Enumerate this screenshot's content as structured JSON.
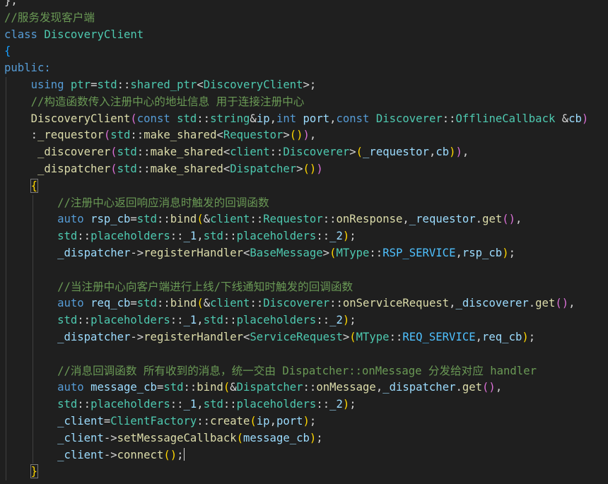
{
  "editor": {
    "lines": [
      {
        "indent": 0,
        "tokens": [
          {
            "t": "};",
            "c": "plain"
          }
        ]
      },
      {
        "indent": 0,
        "tokens": [
          {
            "t": "//服务发现客户端",
            "c": "comment"
          }
        ]
      },
      {
        "indent": 0,
        "tokens": [
          {
            "t": "class",
            "c": "keyword"
          },
          {
            "t": " ",
            "c": "plain"
          },
          {
            "t": "DiscoveryClient",
            "c": "type"
          }
        ]
      },
      {
        "indent": 0,
        "tokens": [
          {
            "t": "{",
            "c": "brace1"
          }
        ]
      },
      {
        "indent": 0,
        "tokens": [
          {
            "t": "public:",
            "c": "keyword"
          }
        ]
      },
      {
        "indent": 1,
        "tokens": [
          {
            "t": "using",
            "c": "keyword"
          },
          {
            "t": " ",
            "c": "plain"
          },
          {
            "t": "ptr",
            "c": "type"
          },
          {
            "t": "=",
            "c": "plain"
          },
          {
            "t": "std",
            "c": "type"
          },
          {
            "t": "::",
            "c": "plain"
          },
          {
            "t": "shared_ptr",
            "c": "type"
          },
          {
            "t": "<",
            "c": "plain"
          },
          {
            "t": "DiscoveryClient",
            "c": "type"
          },
          {
            "t": ">;",
            "c": "plain"
          }
        ]
      },
      {
        "indent": 1,
        "tokens": [
          {
            "t": "//构造函数传入注册中心的地址信息 用于连接注册中心",
            "c": "comment"
          }
        ]
      },
      {
        "indent": 1,
        "tokens": [
          {
            "t": "DiscoveryClient",
            "c": "func"
          },
          {
            "t": "(",
            "c": "brace2"
          },
          {
            "t": "const",
            "c": "keyword"
          },
          {
            "t": " ",
            "c": "plain"
          },
          {
            "t": "std",
            "c": "type"
          },
          {
            "t": "::",
            "c": "plain"
          },
          {
            "t": "string",
            "c": "type"
          },
          {
            "t": "&",
            "c": "plain"
          },
          {
            "t": "ip",
            "c": "var"
          },
          {
            "t": ",",
            "c": "plain"
          },
          {
            "t": "int",
            "c": "keyword"
          },
          {
            "t": " ",
            "c": "plain"
          },
          {
            "t": "port",
            "c": "var"
          },
          {
            "t": ",",
            "c": "plain"
          },
          {
            "t": "const",
            "c": "keyword"
          },
          {
            "t": " ",
            "c": "plain"
          },
          {
            "t": "Discoverer",
            "c": "type"
          },
          {
            "t": "::",
            "c": "plain"
          },
          {
            "t": "OfflineCallback",
            "c": "type"
          },
          {
            "t": " &",
            "c": "plain"
          },
          {
            "t": "cb",
            "c": "var"
          },
          {
            "t": ")",
            "c": "brace2"
          }
        ]
      },
      {
        "indent": 1,
        "tokens": [
          {
            "t": ":",
            "c": "plain"
          },
          {
            "t": "_requestor",
            "c": "func"
          },
          {
            "t": "(",
            "c": "brace2"
          },
          {
            "t": "std",
            "c": "type"
          },
          {
            "t": "::",
            "c": "plain"
          },
          {
            "t": "make_shared",
            "c": "func"
          },
          {
            "t": "<",
            "c": "plain"
          },
          {
            "t": "Requestor",
            "c": "type"
          },
          {
            "t": ">",
            "c": "plain"
          },
          {
            "t": "()",
            "c": "brace3"
          },
          {
            "t": ")",
            "c": "brace2"
          },
          {
            "t": ",",
            "c": "plain"
          }
        ]
      },
      {
        "indent": 1,
        "tokens": [
          {
            "t": " ",
            "c": "plain"
          },
          {
            "t": "_discoverer",
            "c": "func"
          },
          {
            "t": "(",
            "c": "brace2"
          },
          {
            "t": "std",
            "c": "type"
          },
          {
            "t": "::",
            "c": "plain"
          },
          {
            "t": "make_shared",
            "c": "func"
          },
          {
            "t": "<",
            "c": "plain"
          },
          {
            "t": "client",
            "c": "type"
          },
          {
            "t": "::",
            "c": "plain"
          },
          {
            "t": "Discoverer",
            "c": "type"
          },
          {
            "t": ">",
            "c": "plain"
          },
          {
            "t": "(",
            "c": "brace3"
          },
          {
            "t": "_requestor",
            "c": "var"
          },
          {
            "t": ",",
            "c": "plain"
          },
          {
            "t": "cb",
            "c": "var"
          },
          {
            "t": ")",
            "c": "brace3"
          },
          {
            "t": ")",
            "c": "brace2"
          },
          {
            "t": ",",
            "c": "plain"
          }
        ]
      },
      {
        "indent": 1,
        "tokens": [
          {
            "t": " ",
            "c": "plain"
          },
          {
            "t": "_dispatcher",
            "c": "func"
          },
          {
            "t": "(",
            "c": "brace2"
          },
          {
            "t": "std",
            "c": "type"
          },
          {
            "t": "::",
            "c": "plain"
          },
          {
            "t": "make_shared",
            "c": "func"
          },
          {
            "t": "<",
            "c": "plain"
          },
          {
            "t": "Dispatcher",
            "c": "type"
          },
          {
            "t": ">",
            "c": "plain"
          },
          {
            "t": "()",
            "c": "brace3"
          },
          {
            "t": ")",
            "c": "brace2"
          }
        ]
      },
      {
        "indent": 1,
        "tokens": [
          {
            "t": "{",
            "c": "bracematch"
          }
        ]
      },
      {
        "indent": 2,
        "tokens": [
          {
            "t": "//注册中心返回响应消息时触发的回调函数",
            "c": "comment"
          }
        ]
      },
      {
        "indent": 2,
        "tokens": [
          {
            "t": "auto",
            "c": "keyword"
          },
          {
            "t": " ",
            "c": "plain"
          },
          {
            "t": "rsp_cb",
            "c": "var"
          },
          {
            "t": "=",
            "c": "plain"
          },
          {
            "t": "std",
            "c": "type"
          },
          {
            "t": "::",
            "c": "plain"
          },
          {
            "t": "bind",
            "c": "func"
          },
          {
            "t": "(",
            "c": "brace3"
          },
          {
            "t": "&",
            "c": "plain"
          },
          {
            "t": "client",
            "c": "type"
          },
          {
            "t": "::",
            "c": "plain"
          },
          {
            "t": "Requestor",
            "c": "type"
          },
          {
            "t": "::",
            "c": "plain"
          },
          {
            "t": "onResponse",
            "c": "func"
          },
          {
            "t": ",",
            "c": "plain"
          },
          {
            "t": "_requestor",
            "c": "var"
          },
          {
            "t": ".",
            "c": "plain"
          },
          {
            "t": "get",
            "c": "func"
          },
          {
            "t": "()",
            "c": "brace2"
          },
          {
            "t": ",",
            "c": "plain"
          }
        ]
      },
      {
        "indent": 2,
        "tokens": [
          {
            "t": "std",
            "c": "type"
          },
          {
            "t": "::",
            "c": "plain"
          },
          {
            "t": "placeholders",
            "c": "type"
          },
          {
            "t": "::",
            "c": "plain"
          },
          {
            "t": "_1",
            "c": "var"
          },
          {
            "t": ",",
            "c": "plain"
          },
          {
            "t": "std",
            "c": "type"
          },
          {
            "t": "::",
            "c": "plain"
          },
          {
            "t": "placeholders",
            "c": "type"
          },
          {
            "t": "::",
            "c": "plain"
          },
          {
            "t": "_2",
            "c": "var"
          },
          {
            "t": ")",
            "c": "brace3"
          },
          {
            "t": ";",
            "c": "plain"
          }
        ]
      },
      {
        "indent": 2,
        "tokens": [
          {
            "t": "_dispatcher",
            "c": "var"
          },
          {
            "t": "->",
            "c": "plain"
          },
          {
            "t": "registerHandler",
            "c": "func"
          },
          {
            "t": "<",
            "c": "plain"
          },
          {
            "t": "BaseMessage",
            "c": "type"
          },
          {
            "t": ">",
            "c": "plain"
          },
          {
            "t": "(",
            "c": "brace3"
          },
          {
            "t": "MType",
            "c": "type"
          },
          {
            "t": "::",
            "c": "plain"
          },
          {
            "t": "RSP_SERVICE",
            "c": "macro"
          },
          {
            "t": ",",
            "c": "plain"
          },
          {
            "t": "rsp_cb",
            "c": "var"
          },
          {
            "t": ")",
            "c": "brace3"
          },
          {
            "t": ";",
            "c": "plain"
          }
        ]
      },
      {
        "indent": 2,
        "tokens": []
      },
      {
        "indent": 2,
        "tokens": [
          {
            "t": "//当注册中心向客户端进行上线/下线通知时触发的回调函数",
            "c": "comment"
          }
        ]
      },
      {
        "indent": 2,
        "tokens": [
          {
            "t": "auto",
            "c": "keyword"
          },
          {
            "t": " ",
            "c": "plain"
          },
          {
            "t": "req_cb",
            "c": "var"
          },
          {
            "t": "=",
            "c": "plain"
          },
          {
            "t": "std",
            "c": "type"
          },
          {
            "t": "::",
            "c": "plain"
          },
          {
            "t": "bind",
            "c": "func"
          },
          {
            "t": "(",
            "c": "brace3"
          },
          {
            "t": "&",
            "c": "plain"
          },
          {
            "t": "client",
            "c": "type"
          },
          {
            "t": "::",
            "c": "plain"
          },
          {
            "t": "Discoverer",
            "c": "type"
          },
          {
            "t": "::",
            "c": "plain"
          },
          {
            "t": "onServiceRequest",
            "c": "func"
          },
          {
            "t": ",",
            "c": "plain"
          },
          {
            "t": "_discoverer",
            "c": "var"
          },
          {
            "t": ".",
            "c": "plain"
          },
          {
            "t": "get",
            "c": "func"
          },
          {
            "t": "()",
            "c": "brace2"
          },
          {
            "t": ",",
            "c": "plain"
          }
        ]
      },
      {
        "indent": 2,
        "tokens": [
          {
            "t": "std",
            "c": "type"
          },
          {
            "t": "::",
            "c": "plain"
          },
          {
            "t": "placeholders",
            "c": "type"
          },
          {
            "t": "::",
            "c": "plain"
          },
          {
            "t": "_1",
            "c": "var"
          },
          {
            "t": ",",
            "c": "plain"
          },
          {
            "t": "std",
            "c": "type"
          },
          {
            "t": "::",
            "c": "plain"
          },
          {
            "t": "placeholders",
            "c": "type"
          },
          {
            "t": "::",
            "c": "plain"
          },
          {
            "t": "_2",
            "c": "var"
          },
          {
            "t": ")",
            "c": "brace3"
          },
          {
            "t": ";",
            "c": "plain"
          }
        ]
      },
      {
        "indent": 2,
        "tokens": [
          {
            "t": "_dispatcher",
            "c": "var"
          },
          {
            "t": "->",
            "c": "plain"
          },
          {
            "t": "registerHandler",
            "c": "func"
          },
          {
            "t": "<",
            "c": "plain"
          },
          {
            "t": "ServiceRequest",
            "c": "type"
          },
          {
            "t": ">",
            "c": "plain"
          },
          {
            "t": "(",
            "c": "brace3"
          },
          {
            "t": "MType",
            "c": "type"
          },
          {
            "t": "::",
            "c": "plain"
          },
          {
            "t": "REQ_SERVICE",
            "c": "macro"
          },
          {
            "t": ",",
            "c": "plain"
          },
          {
            "t": "req_cb",
            "c": "var"
          },
          {
            "t": ")",
            "c": "brace3"
          },
          {
            "t": ";",
            "c": "plain"
          }
        ]
      },
      {
        "indent": 2,
        "tokens": []
      },
      {
        "indent": 2,
        "tokens": [
          {
            "t": "//消息回调函数 所有收到的消息，统一交由 Dispatcher::onMessage 分发给对应 handler",
            "c": "comment"
          }
        ]
      },
      {
        "indent": 2,
        "tokens": [
          {
            "t": "auto",
            "c": "keyword"
          },
          {
            "t": " ",
            "c": "plain"
          },
          {
            "t": "message_cb",
            "c": "var"
          },
          {
            "t": "=",
            "c": "plain"
          },
          {
            "t": "std",
            "c": "type"
          },
          {
            "t": "::",
            "c": "plain"
          },
          {
            "t": "bind",
            "c": "func"
          },
          {
            "t": "(",
            "c": "brace3"
          },
          {
            "t": "&",
            "c": "plain"
          },
          {
            "t": "Dispatcher",
            "c": "type"
          },
          {
            "t": "::",
            "c": "plain"
          },
          {
            "t": "onMessage",
            "c": "func"
          },
          {
            "t": ",",
            "c": "plain"
          },
          {
            "t": "_dispatcher",
            "c": "var"
          },
          {
            "t": ".",
            "c": "plain"
          },
          {
            "t": "get",
            "c": "func"
          },
          {
            "t": "()",
            "c": "brace2"
          },
          {
            "t": ",",
            "c": "plain"
          }
        ]
      },
      {
        "indent": 2,
        "tokens": [
          {
            "t": "std",
            "c": "type"
          },
          {
            "t": "::",
            "c": "plain"
          },
          {
            "t": "placeholders",
            "c": "type"
          },
          {
            "t": "::",
            "c": "plain"
          },
          {
            "t": "_1",
            "c": "var"
          },
          {
            "t": ",",
            "c": "plain"
          },
          {
            "t": "std",
            "c": "type"
          },
          {
            "t": "::",
            "c": "plain"
          },
          {
            "t": "placeholders",
            "c": "type"
          },
          {
            "t": "::",
            "c": "plain"
          },
          {
            "t": "_2",
            "c": "var"
          },
          {
            "t": ")",
            "c": "brace3"
          },
          {
            "t": ";",
            "c": "plain"
          }
        ]
      },
      {
        "indent": 2,
        "tokens": [
          {
            "t": "_client",
            "c": "var"
          },
          {
            "t": "=",
            "c": "plain"
          },
          {
            "t": "ClientFactory",
            "c": "type"
          },
          {
            "t": "::",
            "c": "plain"
          },
          {
            "t": "create",
            "c": "func"
          },
          {
            "t": "(",
            "c": "brace3"
          },
          {
            "t": "ip",
            "c": "var"
          },
          {
            "t": ",",
            "c": "plain"
          },
          {
            "t": "port",
            "c": "var"
          },
          {
            "t": ")",
            "c": "brace3"
          },
          {
            "t": ";",
            "c": "plain"
          }
        ]
      },
      {
        "indent": 2,
        "tokens": [
          {
            "t": "_client",
            "c": "var"
          },
          {
            "t": "->",
            "c": "plain"
          },
          {
            "t": "setMessageCallback",
            "c": "func"
          },
          {
            "t": "(",
            "c": "brace3"
          },
          {
            "t": "message_cb",
            "c": "var"
          },
          {
            "t": ")",
            "c": "brace3"
          },
          {
            "t": ";",
            "c": "plain"
          }
        ]
      },
      {
        "indent": 2,
        "cursor": true,
        "tokens": [
          {
            "t": "_client",
            "c": "var"
          },
          {
            "t": "->",
            "c": "plain"
          },
          {
            "t": "connect",
            "c": "func"
          },
          {
            "t": "()",
            "c": "brace3"
          },
          {
            "t": ";",
            "c": "plain"
          }
        ]
      },
      {
        "indent": 1,
        "tokens": [
          {
            "t": "}",
            "c": "bracematch"
          }
        ]
      }
    ]
  },
  "colors": {
    "background": "#1f1f1f",
    "comment": "#6a9955",
    "keyword": "#569cd6",
    "type": "#4ec9b0",
    "function": "#dcdcaa",
    "variable": "#9cdcfe",
    "macro": "#4fc1ff"
  }
}
